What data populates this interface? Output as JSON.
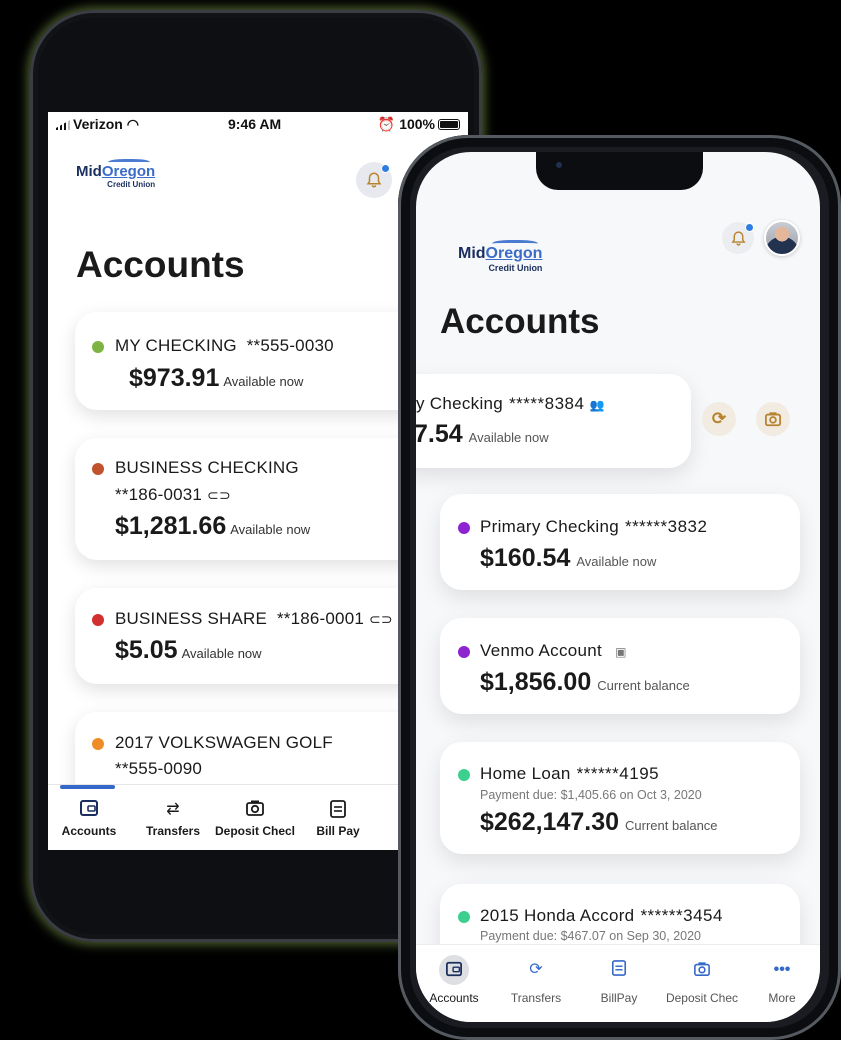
{
  "back_phone": {
    "status": {
      "carrier": "Verizon",
      "time": "9:46 AM",
      "battery": "100%"
    },
    "logo": {
      "mid": "Mid",
      "oregon": "Oregon",
      "credit_union": "Credit Union"
    },
    "title": "Accounts",
    "accounts": [
      {
        "name": "MY CHECKING",
        "number": "**555-0030",
        "amount": "$973.91",
        "balance_label": "Available now",
        "dot_color": "#7cb342"
      },
      {
        "name": "BUSINESS CHECKING",
        "number": "**186-0031",
        "amount": "$1,281.66",
        "balance_label": "Available now",
        "dot_color": "#c0532c"
      },
      {
        "name": "BUSINESS SHARE",
        "number": "**186-0001",
        "amount": "$5.05",
        "balance_label": "Available now",
        "dot_color": "#d32f2f"
      },
      {
        "name": "2017 VOLKSWAGEN GOLF",
        "number": "**555-0090",
        "dot_color": "#ef8c26"
      }
    ],
    "tabs": [
      {
        "label": "Accounts",
        "icon": "wallet-icon"
      },
      {
        "label": "Transfers",
        "icon": "transfer-icon"
      },
      {
        "label": "Deposit Checl",
        "icon": "camera-icon"
      },
      {
        "label": "Bill Pay",
        "icon": "bill-icon"
      }
    ]
  },
  "front_phone": {
    "logo": {
      "mid": "Mid",
      "oregon": "Oregon",
      "credit_union": "Credit Union"
    },
    "title": "Accounts",
    "swiped_account": {
      "name": "ry Checking",
      "number": "*****8384",
      "amount": "7.54",
      "balance_label": "Available now"
    },
    "accounts": [
      {
        "name": "Primary Checking",
        "number": "******3832",
        "amount": "$160.54",
        "balance_label": "Available now",
        "dot_color": "#8e24d0"
      },
      {
        "name": "Venmo Account",
        "amount": "$1,856.00",
        "balance_label": "Current balance",
        "dot_color": "#8e24d0"
      },
      {
        "name": "Home Loan",
        "number": "******4195",
        "note": "Payment due: $1,405.66 on Oct 3, 2020",
        "amount": "$262,147.30",
        "balance_label": "Current balance",
        "dot_color": "#3ccf8e"
      },
      {
        "name": "2015 Honda Accord",
        "number": "******3454",
        "note": "Payment due: $467.07 on Sep 30, 2020",
        "dot_color": "#3ccf8e"
      }
    ],
    "tabs": [
      {
        "label": "Accounts",
        "icon": "wallet-icon"
      },
      {
        "label": "Transfers",
        "icon": "transfer-icon"
      },
      {
        "label": "BillPay",
        "icon": "bill-icon"
      },
      {
        "label": "Deposit Chec",
        "icon": "camera-icon"
      },
      {
        "label": "More",
        "icon": "more-icon"
      }
    ],
    "accent_color": "#3569c9",
    "action_color": "#b8832f"
  }
}
